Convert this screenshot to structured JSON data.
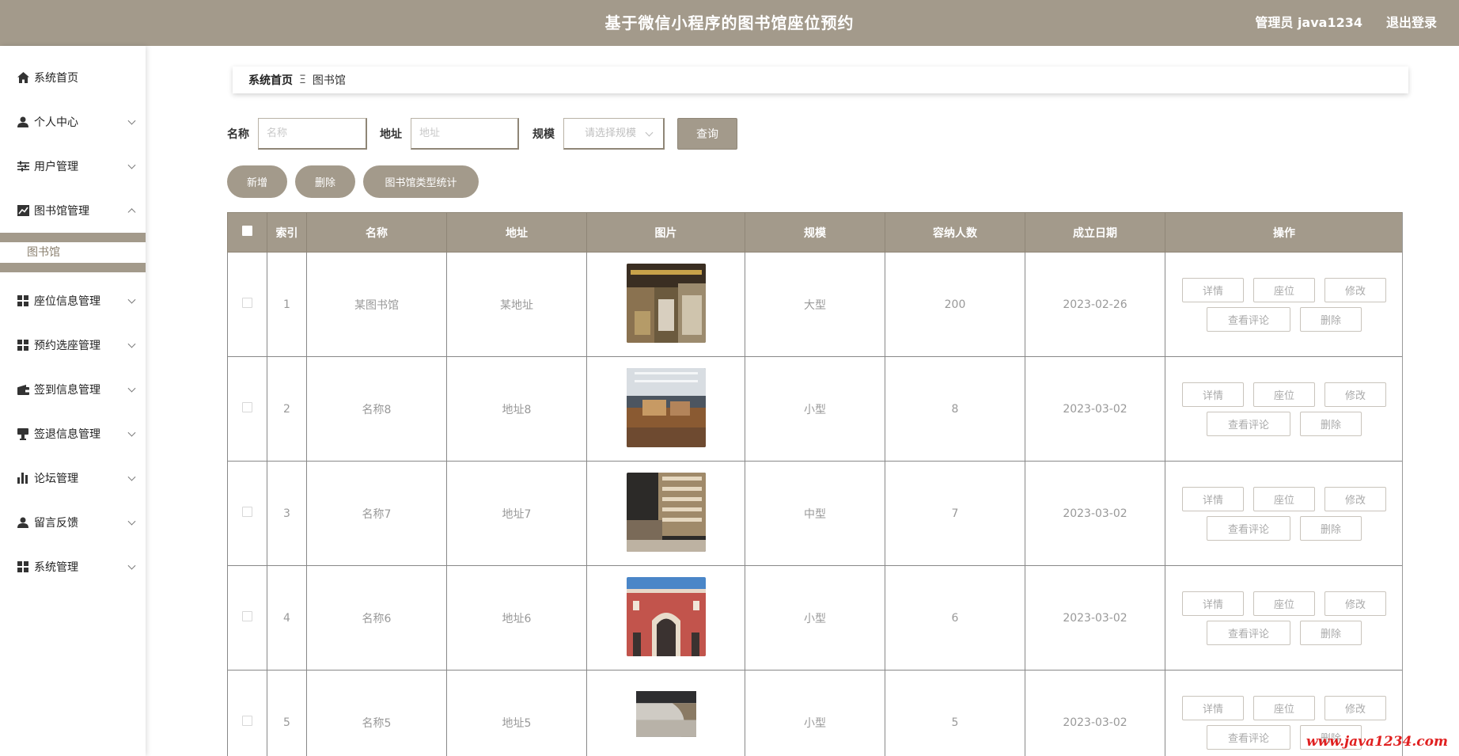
{
  "header": {
    "title": "基于微信小程序的图书馆座位预约",
    "user": "管理员 java1234",
    "logout": "退出登录"
  },
  "sidebar": {
    "items": [
      {
        "label": "系统首页",
        "icon": "home-icon"
      },
      {
        "label": "个人中心",
        "icon": "user-icon"
      },
      {
        "label": "用户管理",
        "icon": "sliders-icon"
      },
      {
        "label": "图书馆管理",
        "icon": "chart-line-icon"
      },
      {
        "label": "座位信息管理",
        "icon": "grid-icon"
      },
      {
        "label": "预约选座管理",
        "icon": "grid-icon"
      },
      {
        "label": "签到信息管理",
        "icon": "wallet-icon"
      },
      {
        "label": "签退信息管理",
        "icon": "stamp-icon"
      },
      {
        "label": "论坛管理",
        "icon": "bar-chart-icon"
      },
      {
        "label": "留言反馈",
        "icon": "user-icon"
      },
      {
        "label": "系统管理",
        "icon": "grid-icon"
      }
    ],
    "submenu": {
      "label": "图书馆"
    }
  },
  "breadcrumb": {
    "home": "系统首页",
    "separator": "Ξ",
    "current": "图书馆"
  },
  "search": {
    "name_label": "名称",
    "name_placeholder": "名称",
    "address_label": "地址",
    "address_placeholder": "地址",
    "scale_label": "规模",
    "scale_placeholder": "请选择规模",
    "query": "查询"
  },
  "actions": {
    "add": "新增",
    "delete": "删除",
    "stats": "图书馆类型统计"
  },
  "table": {
    "headers": [
      "索引",
      "名称",
      "地址",
      "图片",
      "规模",
      "容纳人数",
      "成立日期",
      "操作"
    ],
    "ops": {
      "detail": "详情",
      "seat": "座位",
      "edit": "修改",
      "comments": "查看评论",
      "delete": "删除"
    },
    "rows": [
      {
        "index": "1",
        "name": "某图书馆",
        "address": "某地址",
        "scale": "大型",
        "capacity": "200",
        "date": "2023-02-26"
      },
      {
        "index": "2",
        "name": "名称8",
        "address": "地址8",
        "scale": "小型",
        "capacity": "8",
        "date": "2023-03-02"
      },
      {
        "index": "3",
        "name": "名称7",
        "address": "地址7",
        "scale": "中型",
        "capacity": "7",
        "date": "2023-03-02"
      },
      {
        "index": "4",
        "name": "名称6",
        "address": "地址6",
        "scale": "小型",
        "capacity": "6",
        "date": "2023-03-02"
      },
      {
        "index": "5",
        "name": "名称5",
        "address": "地址5",
        "scale": "小型",
        "capacity": "5",
        "date": "2023-03-02"
      }
    ]
  },
  "watermark": "www.java1234.com",
  "colors": {
    "accent": "#a39a8b",
    "accent_dark": "#8f8677",
    "watermark": "#e02020"
  }
}
